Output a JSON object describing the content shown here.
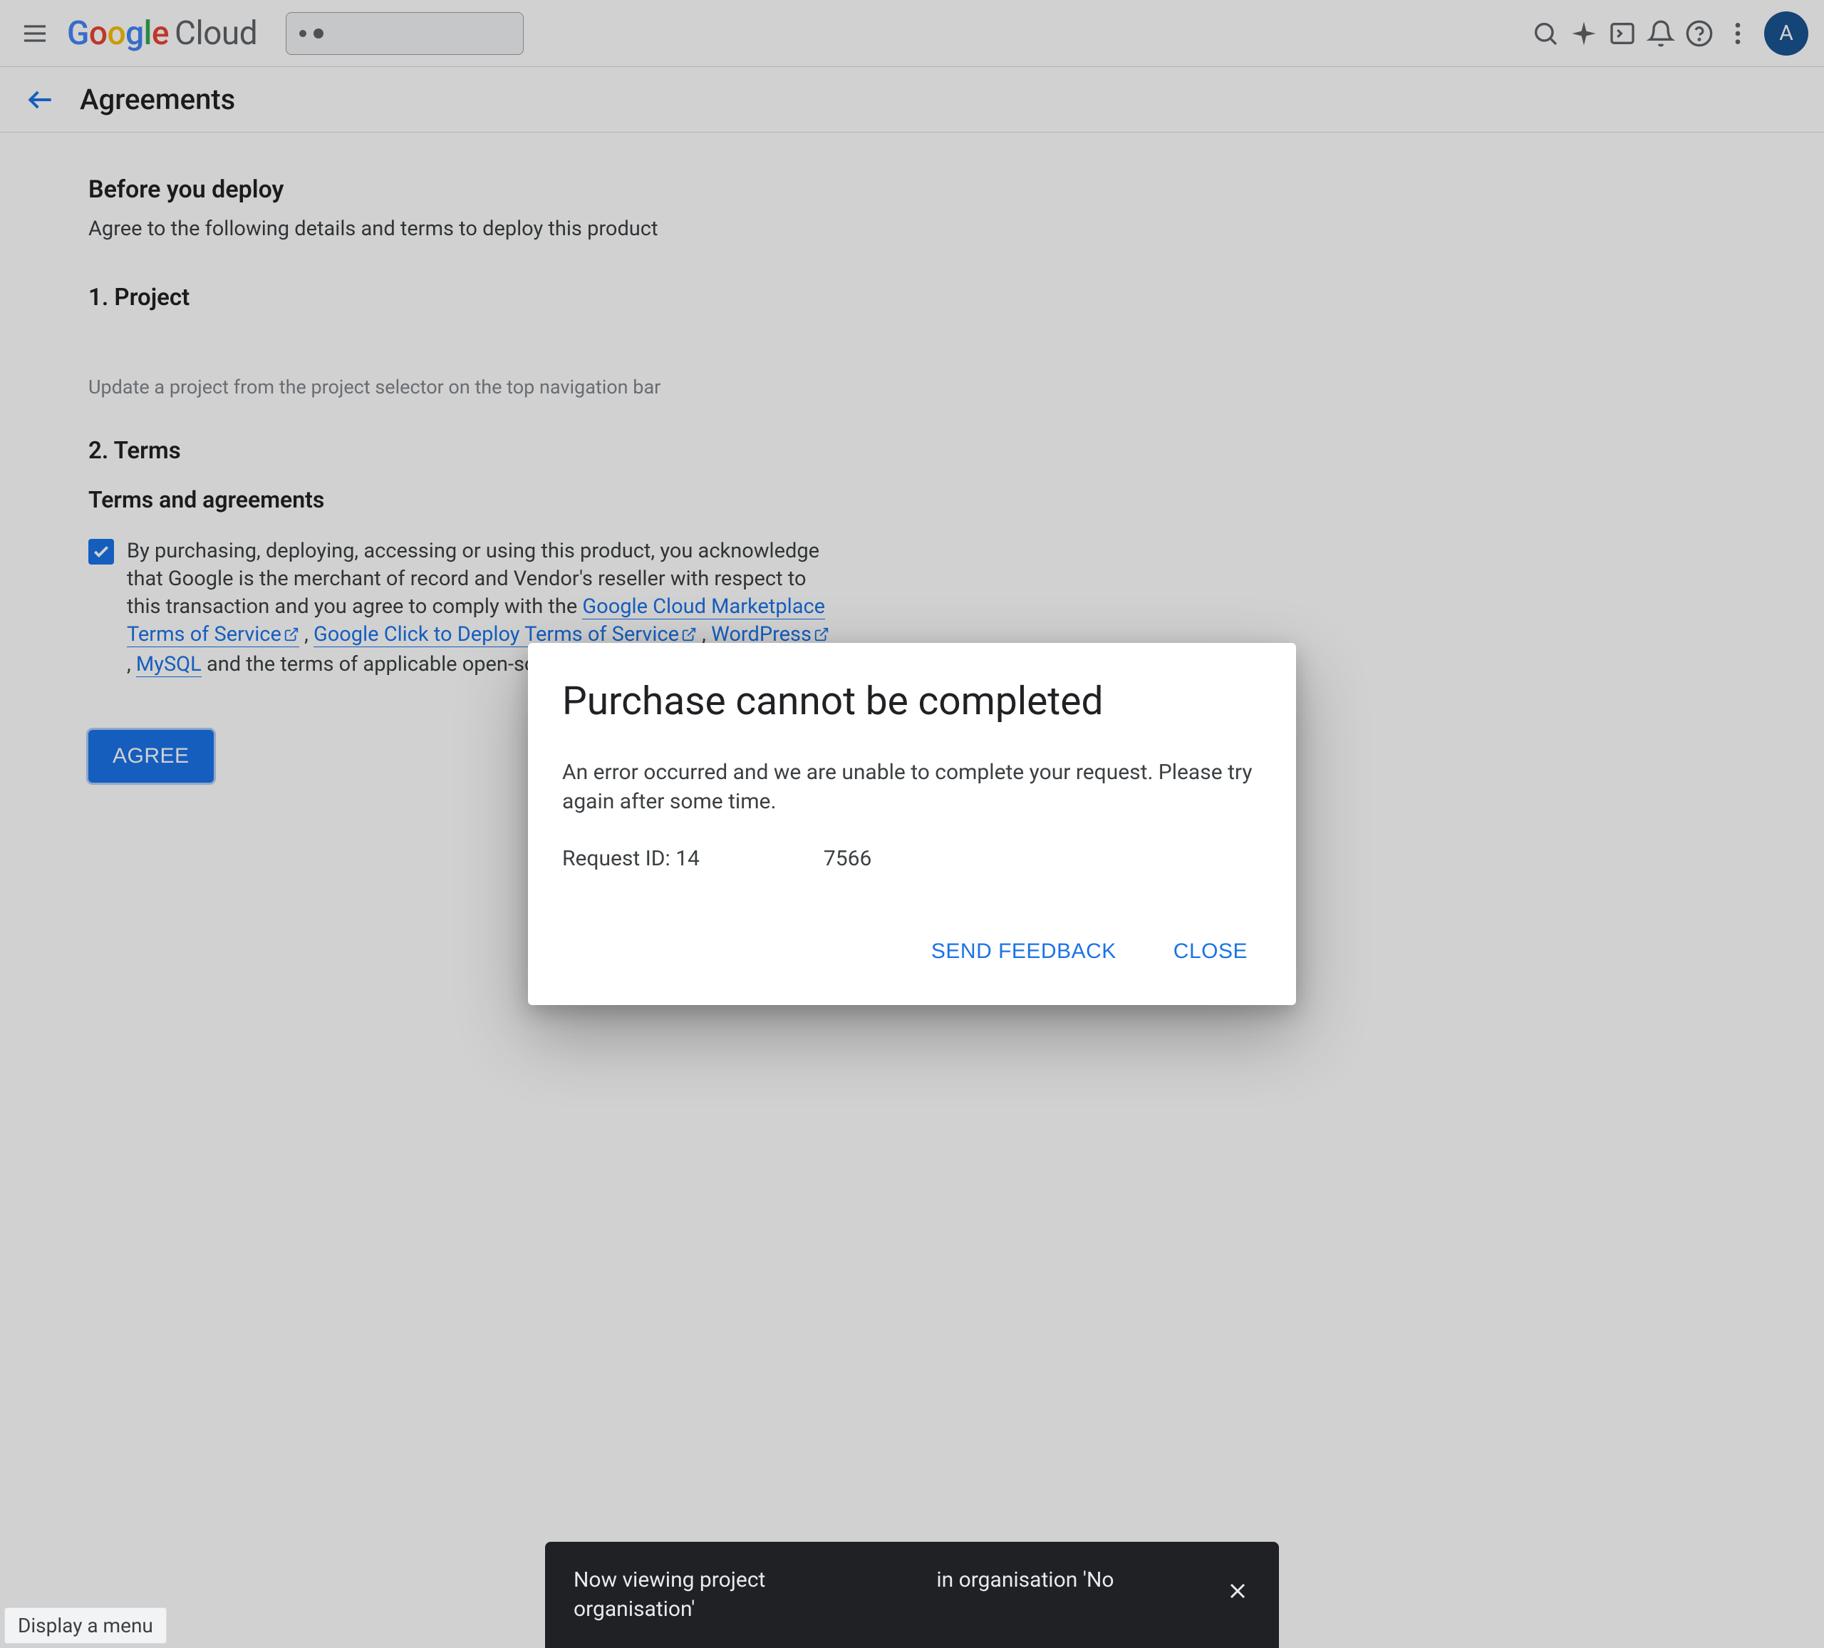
{
  "header": {
    "logo_text": "Google",
    "logo_suffix": "Cloud",
    "avatar_initial": "A"
  },
  "subheader": {
    "title": "Agreements"
  },
  "content": {
    "before_heading": "Before you deploy",
    "before_desc": "Agree to the following details and terms to deploy this product",
    "step1": "1. Project",
    "project_hint": "Update a project from the project selector on the top navigation bar",
    "step2": "2. Terms",
    "terms_heading": "Terms and agreements",
    "terms_pre": "By purchasing, deploying, accessing or using this product, you acknowledge that Google is the merchant of record and Vendor's reseller with respect to this transaction and you agree to comply with the ",
    "link_marketplace": "Google Cloud Marketplace Terms of Service",
    "comma1": " , ",
    "link_clicktodeploy": "Google Click to Deploy Terms of Service",
    "comma2": " , ",
    "link_wordpress": "WordPress",
    "comma3": " , ",
    "link_mysql": "MySQL",
    "terms_post": " and the terms of applicable open-source software li",
    "agree_label": "AGREE"
  },
  "dialog": {
    "title": "Purchase cannot be completed",
    "body": "An error occurred and we are unable to complete your request. Please try again after some time.",
    "request_label": "Request ID: ",
    "request_value_prefix": "14",
    "request_value_suffix": "7566",
    "send_feedback": "SEND FEEDBACK",
    "close": "CLOSE"
  },
  "toast": {
    "line1_a": "Now viewing project",
    "line1_b": "in organisation 'No",
    "line2": "organisation'"
  },
  "menu_hint": "Display a menu"
}
